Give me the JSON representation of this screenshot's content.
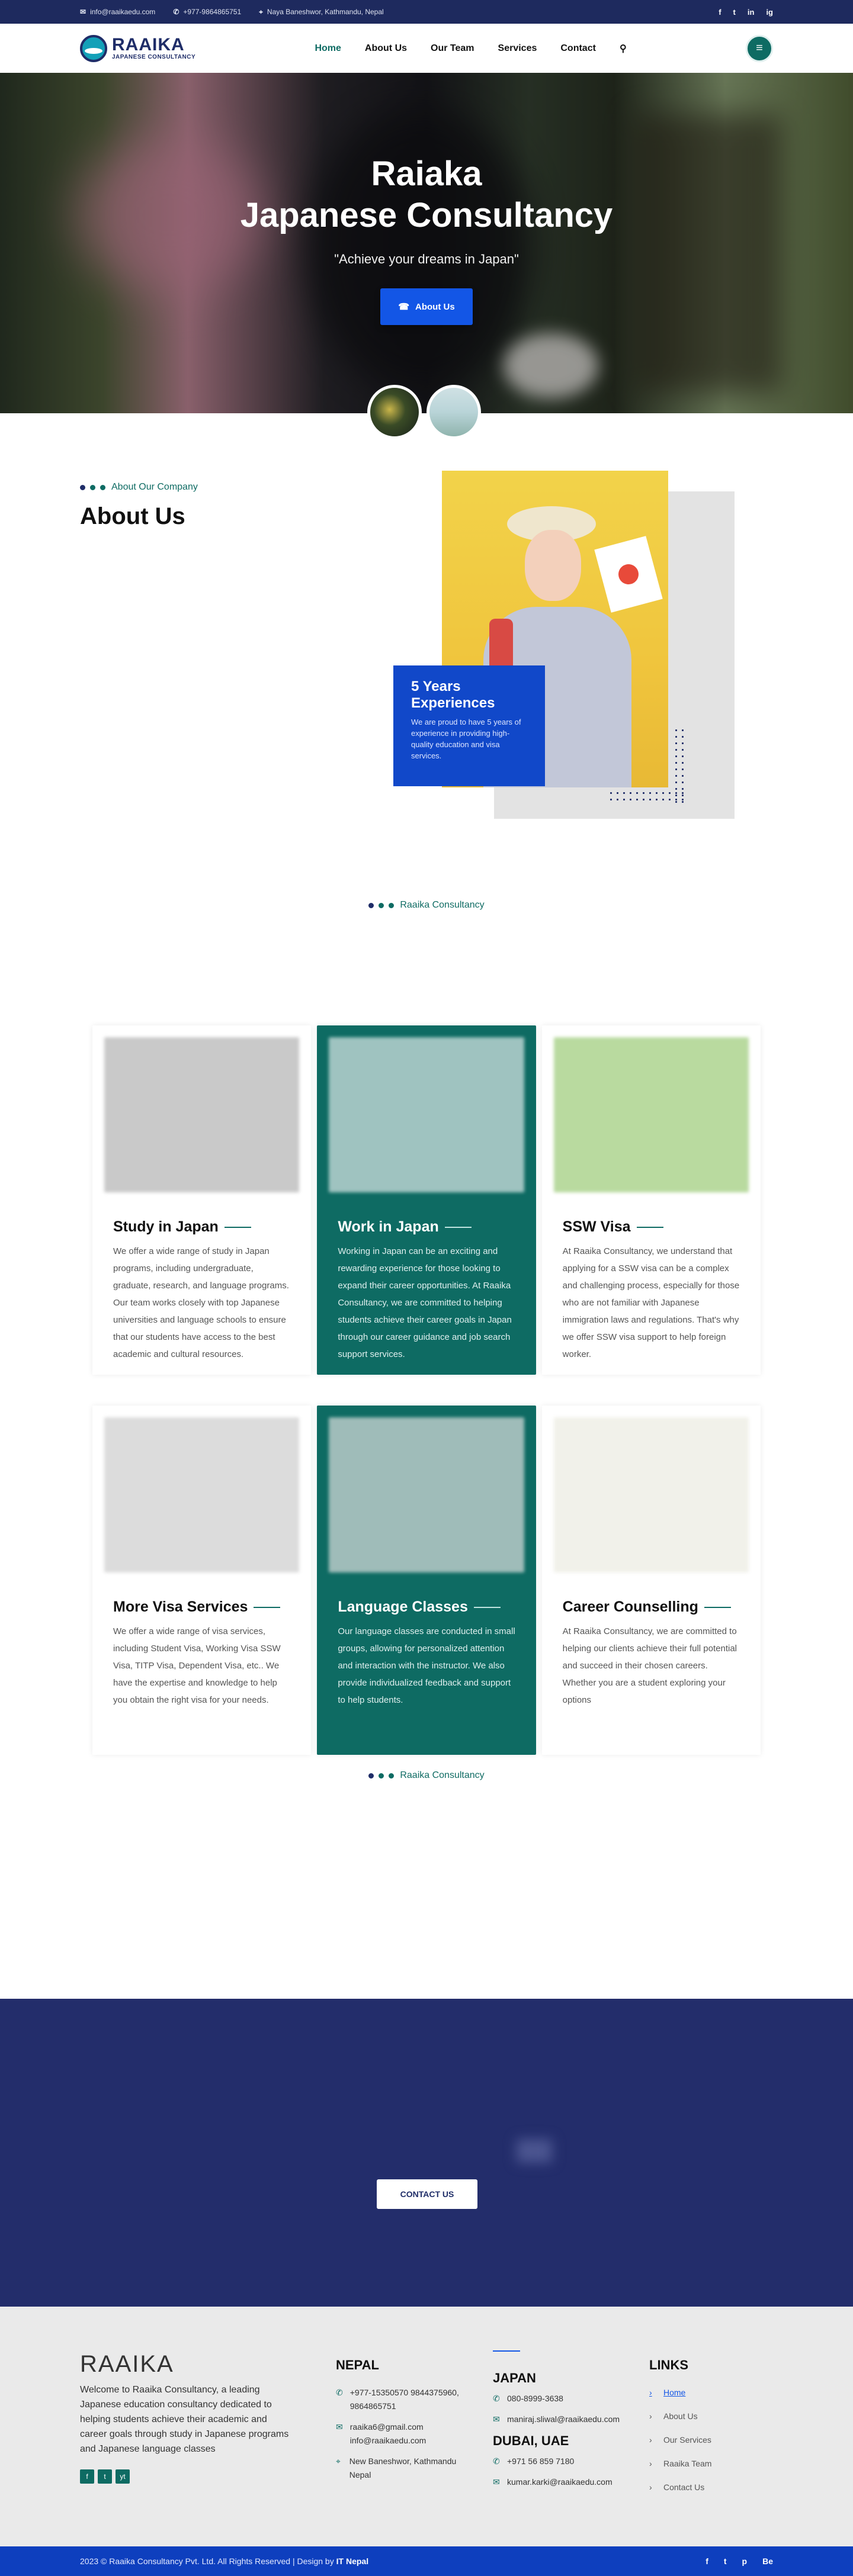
{
  "topbar": {
    "email": "info@raaikaedu.com",
    "phone": "+977-9864865751",
    "address": "Naya Baneshwor, Kathmandu, Nepal",
    "social": [
      "f",
      "t",
      "in",
      "ig"
    ]
  },
  "brand": {
    "name": "RAAIKA",
    "tagline": "JAPANESE CONSULTANCY"
  },
  "nav": {
    "items": [
      "Home",
      "About Us",
      "Our Team",
      "Services",
      "Contact"
    ]
  },
  "hero": {
    "title_line1": "Raiaka",
    "title_line2": "Japanese Consultancy",
    "quote": "\"Achieve your dreams in Japan\"",
    "button": "About Us"
  },
  "about": {
    "eyebrow": "About Our Company",
    "title": "About Us",
    "exp_title": "5 Years Experiences",
    "exp_text": "We are proud to have 5 years of experience in providing high-quality education and visa services."
  },
  "services": {
    "eyebrow": "Raaika Consultancy",
    "cards": [
      {
        "title": "Study in Japan",
        "text": "We offer a wide range of study in Japan programs, including undergraduate, graduate, research, and language programs. Our team works closely with top Japanese universities and language schools to ensure that our students have access to the best academic and cultural resources.",
        "color": "#c9c9c9"
      },
      {
        "title": "Work in Japan",
        "text": "Working in Japan can be an exciting and rewarding experience for those looking to expand their career opportunities. At Raaika Consultancy, we are committed to helping students achieve their career goals in Japan through our career guidance and job search support services.",
        "color": "#9fc3c0"
      },
      {
        "title": "SSW Visa",
        "text": "At Raaika Consultancy, we understand that applying for a SSW visa can be a complex and challenging process, especially for those who are not familiar with Japanese immigration laws and regulations. That's why we offer SSW visa support to help foreign worker.",
        "color": "#b9da9f"
      },
      {
        "title": "More Visa Services",
        "text": "We offer a wide range of visa services, including Student Visa, Working Visa SSW Visa, TITP Visa, Dependent Visa, etc.. We have the expertise and knowledge to help you obtain the right visa for your needs.",
        "color": "#dcdcdc"
      },
      {
        "title": "Language Classes",
        "text": "Our language classes are conducted in small groups, allowing for personalized attention and interaction with the instructor. We also provide individualized feedback and support to help students.",
        "color": "#9fbcb9"
      },
      {
        "title": "Career Counselling",
        "text": "At Raaika Consultancy, we are committed to helping our clients achieve their full potential and succeed in their chosen careers. Whether you are a student exploring your options",
        "color": "#f1f1ea"
      }
    ]
  },
  "team": {
    "eyebrow": "Raaika Consultancy"
  },
  "cta": {
    "button": "CONTACT US"
  },
  "footer": {
    "name": "RAAIKA",
    "about": "Welcome to Raaika Consultancy, a leading Japanese education consultancy dedicated to helping students achieve their academic and career goals through study in Japanese programs and Japanese language classes",
    "social": [
      "f",
      "t",
      "yt"
    ],
    "nepal": {
      "title": "NEPAL",
      "phone": "+977-15350570 9844375960, 9864865751",
      "email": "raaika6@gmail.com info@raaikaedu.com",
      "address": "New Baneshwor, Kathmandu Nepal"
    },
    "japan": {
      "title": "JAPAN",
      "phone": "080-8999-3638",
      "email": "maniraj.sliwal@raaikaedu.com"
    },
    "dubai": {
      "title": "DUBAI, UAE",
      "phone": "+971 56 859 7180",
      "email": "kumar.karki@raaikaedu.com"
    },
    "links": {
      "title": "LINKS",
      "items": [
        "Home",
        "About Us",
        "Our Services",
        "Raaika Team",
        "Contact Us"
      ]
    }
  },
  "bottom": {
    "copy": "2023 © Raaika Consultancy Pvt. Ltd. All Rights Reserved | Design by",
    "designer": "IT Nepal",
    "social": [
      "f",
      "t",
      "p",
      "Be"
    ]
  }
}
